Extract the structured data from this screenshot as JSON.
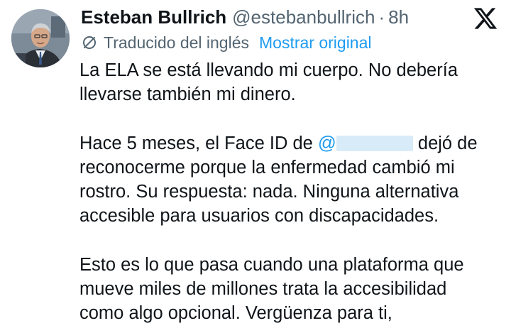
{
  "tweet": {
    "author": {
      "display_name": "Esteban Bullrich",
      "handle": "@estebanbullrich",
      "avatar_icon": "profile-photo"
    },
    "separator": "·",
    "time_ago": "8h",
    "platform_icon": "x-logo-icon",
    "translation": {
      "label": "Traducido del inglés",
      "show_original": "Mostrar original",
      "icon": "translate-icon"
    },
    "paragraphs": [
      {
        "lines": [
          "La ELA se está llevando mi cuerpo. No debería",
          "llevarse también mi dinero."
        ]
      },
      {
        "line1_before": "Hace 5 meses, el Face ID de ",
        "mention_prefix": "@",
        "line1_after": " dejó de",
        "lines_rest": [
          "reconocerme porque la enfermedad cambió mi",
          "rostro. Su respuesta: nada. Ninguna alternativa",
          "accesible para usuarios con discapacidades."
        ]
      },
      {
        "lines": [
          "Esto es lo que pasa cuando una plataforma que",
          "mueve miles de millones trata la accesibilidad",
          "como algo opcional. Vergüenza para ti,"
        ]
      }
    ],
    "colors": {
      "text": "#0f1419",
      "secondary": "#536471",
      "link": "#1d9bf0"
    }
  }
}
